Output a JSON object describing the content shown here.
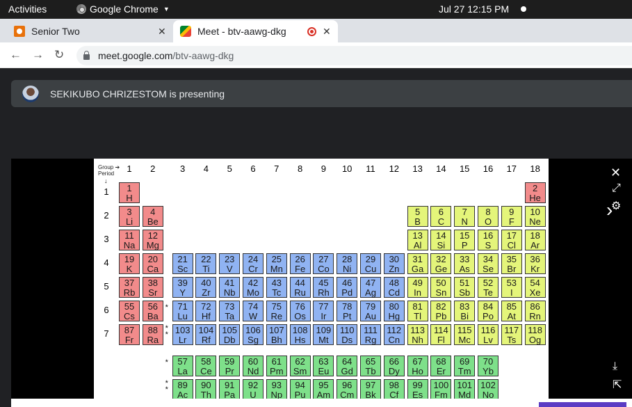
{
  "topbar": {
    "activities": "Activities",
    "app_name": "Google Chrome",
    "clock": "Jul 27  12:15 PM"
  },
  "tabs": [
    {
      "title": "Senior Two",
      "close": "✕"
    },
    {
      "title": "Meet - btv-aawg-dkg",
      "close": "✕"
    }
  ],
  "new_tab": "+",
  "nav": {
    "back": "←",
    "forward": "→",
    "reload": "↻"
  },
  "url": {
    "host": "meet.google.com",
    "path": "/btv-aawg-dkg"
  },
  "banner": {
    "text": "SEKIKUBO CHRIZESTOM is presenting"
  },
  "controls": {
    "close": "✕",
    "expand": "⤢",
    "settings": "⚙",
    "next": "›",
    "download": "⤓",
    "share": "⇱"
  },
  "periodic_table": {
    "header_group": "Group",
    "header_period": "Period",
    "groups": [
      "1",
      "2",
      "3",
      "4",
      "5",
      "6",
      "7",
      "8",
      "9",
      "10",
      "11",
      "12",
      "13",
      "14",
      "15",
      "16",
      "17",
      "18"
    ],
    "periods": [
      "1",
      "2",
      "3",
      "4",
      "5",
      "6",
      "7"
    ],
    "elements": [
      {
        "n": "1",
        "s": "H",
        "r": 1,
        "c": 1,
        "b": "s"
      },
      {
        "n": "2",
        "s": "He",
        "r": 1,
        "c": 18,
        "b": "s"
      },
      {
        "n": "3",
        "s": "Li",
        "r": 2,
        "c": 1,
        "b": "s"
      },
      {
        "n": "4",
        "s": "Be",
        "r": 2,
        "c": 2,
        "b": "s"
      },
      {
        "n": "5",
        "s": "B",
        "r": 2,
        "c": 13,
        "b": "p"
      },
      {
        "n": "6",
        "s": "C",
        "r": 2,
        "c": 14,
        "b": "p"
      },
      {
        "n": "7",
        "s": "N",
        "r": 2,
        "c": 15,
        "b": "p"
      },
      {
        "n": "8",
        "s": "O",
        "r": 2,
        "c": 16,
        "b": "p"
      },
      {
        "n": "9",
        "s": "F",
        "r": 2,
        "c": 17,
        "b": "p"
      },
      {
        "n": "10",
        "s": "Ne",
        "r": 2,
        "c": 18,
        "b": "p"
      },
      {
        "n": "11",
        "s": "Na",
        "r": 3,
        "c": 1,
        "b": "s"
      },
      {
        "n": "12",
        "s": "Mg",
        "r": 3,
        "c": 2,
        "b": "s"
      },
      {
        "n": "13",
        "s": "Al",
        "r": 3,
        "c": 13,
        "b": "p"
      },
      {
        "n": "14",
        "s": "Si",
        "r": 3,
        "c": 14,
        "b": "p"
      },
      {
        "n": "15",
        "s": "P",
        "r": 3,
        "c": 15,
        "b": "p"
      },
      {
        "n": "16",
        "s": "S",
        "r": 3,
        "c": 16,
        "b": "p"
      },
      {
        "n": "17",
        "s": "Cl",
        "r": 3,
        "c": 17,
        "b": "p"
      },
      {
        "n": "18",
        "s": "Ar",
        "r": 3,
        "c": 18,
        "b": "p"
      },
      {
        "n": "19",
        "s": "K",
        "r": 4,
        "c": 1,
        "b": "s"
      },
      {
        "n": "20",
        "s": "Ca",
        "r": 4,
        "c": 2,
        "b": "s"
      },
      {
        "n": "21",
        "s": "Sc",
        "r": 4,
        "c": 3,
        "b": "d"
      },
      {
        "n": "22",
        "s": "Ti",
        "r": 4,
        "c": 4,
        "b": "d"
      },
      {
        "n": "23",
        "s": "V",
        "r": 4,
        "c": 5,
        "b": "d"
      },
      {
        "n": "24",
        "s": "Cr",
        "r": 4,
        "c": 6,
        "b": "d"
      },
      {
        "n": "25",
        "s": "Mn",
        "r": 4,
        "c": 7,
        "b": "d"
      },
      {
        "n": "26",
        "s": "Fe",
        "r": 4,
        "c": 8,
        "b": "d"
      },
      {
        "n": "27",
        "s": "Co",
        "r": 4,
        "c": 9,
        "b": "d"
      },
      {
        "n": "28",
        "s": "Ni",
        "r": 4,
        "c": 10,
        "b": "d"
      },
      {
        "n": "29",
        "s": "Cu",
        "r": 4,
        "c": 11,
        "b": "d"
      },
      {
        "n": "30",
        "s": "Zn",
        "r": 4,
        "c": 12,
        "b": "d"
      },
      {
        "n": "31",
        "s": "Ga",
        "r": 4,
        "c": 13,
        "b": "p"
      },
      {
        "n": "32",
        "s": "Ge",
        "r": 4,
        "c": 14,
        "b": "p"
      },
      {
        "n": "33",
        "s": "As",
        "r": 4,
        "c": 15,
        "b": "p"
      },
      {
        "n": "34",
        "s": "Se",
        "r": 4,
        "c": 16,
        "b": "p"
      },
      {
        "n": "35",
        "s": "Br",
        "r": 4,
        "c": 17,
        "b": "p"
      },
      {
        "n": "36",
        "s": "Kr",
        "r": 4,
        "c": 18,
        "b": "p"
      },
      {
        "n": "37",
        "s": "Rb",
        "r": 5,
        "c": 1,
        "b": "s"
      },
      {
        "n": "38",
        "s": "Sr",
        "r": 5,
        "c": 2,
        "b": "s"
      },
      {
        "n": "39",
        "s": "Y",
        "r": 5,
        "c": 3,
        "b": "d"
      },
      {
        "n": "40",
        "s": "Zr",
        "r": 5,
        "c": 4,
        "b": "d"
      },
      {
        "n": "41",
        "s": "Nb",
        "r": 5,
        "c": 5,
        "b": "d"
      },
      {
        "n": "42",
        "s": "Mo",
        "r": 5,
        "c": 6,
        "b": "d"
      },
      {
        "n": "43",
        "s": "Tc",
        "r": 5,
        "c": 7,
        "b": "d"
      },
      {
        "n": "44",
        "s": "Ru",
        "r": 5,
        "c": 8,
        "b": "d"
      },
      {
        "n": "45",
        "s": "Rh",
        "r": 5,
        "c": 9,
        "b": "d"
      },
      {
        "n": "46",
        "s": "Pd",
        "r": 5,
        "c": 10,
        "b": "d"
      },
      {
        "n": "47",
        "s": "Ag",
        "r": 5,
        "c": 11,
        "b": "d"
      },
      {
        "n": "48",
        "s": "Cd",
        "r": 5,
        "c": 12,
        "b": "d"
      },
      {
        "n": "49",
        "s": "In",
        "r": 5,
        "c": 13,
        "b": "p"
      },
      {
        "n": "50",
        "s": "Sn",
        "r": 5,
        "c": 14,
        "b": "p"
      },
      {
        "n": "51",
        "s": "Sb",
        "r": 5,
        "c": 15,
        "b": "p"
      },
      {
        "n": "52",
        "s": "Te",
        "r": 5,
        "c": 16,
        "b": "p"
      },
      {
        "n": "53",
        "s": "I",
        "r": 5,
        "c": 17,
        "b": "p"
      },
      {
        "n": "54",
        "s": "Xe",
        "r": 5,
        "c": 18,
        "b": "p"
      },
      {
        "n": "55",
        "s": "Cs",
        "r": 6,
        "c": 1,
        "b": "s"
      },
      {
        "n": "56",
        "s": "Ba",
        "r": 6,
        "c": 2,
        "b": "s"
      },
      {
        "n": "71",
        "s": "Lu",
        "r": 6,
        "c": 3,
        "b": "d"
      },
      {
        "n": "72",
        "s": "Hf",
        "r": 6,
        "c": 4,
        "b": "d"
      },
      {
        "n": "73",
        "s": "Ta",
        "r": 6,
        "c": 5,
        "b": "d"
      },
      {
        "n": "74",
        "s": "W",
        "r": 6,
        "c": 6,
        "b": "d"
      },
      {
        "n": "75",
        "s": "Re",
        "r": 6,
        "c": 7,
        "b": "d"
      },
      {
        "n": "76",
        "s": "Os",
        "r": 6,
        "c": 8,
        "b": "d"
      },
      {
        "n": "77",
        "s": "Ir",
        "r": 6,
        "c": 9,
        "b": "d"
      },
      {
        "n": "78",
        "s": "Pt",
        "r": 6,
        "c": 10,
        "b": "d"
      },
      {
        "n": "79",
        "s": "Au",
        "r": 6,
        "c": 11,
        "b": "d"
      },
      {
        "n": "80",
        "s": "Hg",
        "r": 6,
        "c": 12,
        "b": "d"
      },
      {
        "n": "81",
        "s": "Tl",
        "r": 6,
        "c": 13,
        "b": "p"
      },
      {
        "n": "82",
        "s": "Pb",
        "r": 6,
        "c": 14,
        "b": "p"
      },
      {
        "n": "83",
        "s": "Bi",
        "r": 6,
        "c": 15,
        "b": "p"
      },
      {
        "n": "84",
        "s": "Po",
        "r": 6,
        "c": 16,
        "b": "p"
      },
      {
        "n": "85",
        "s": "At",
        "r": 6,
        "c": 17,
        "b": "p"
      },
      {
        "n": "86",
        "s": "Rn",
        "r": 6,
        "c": 18,
        "b": "p"
      },
      {
        "n": "87",
        "s": "Fr",
        "r": 7,
        "c": 1,
        "b": "s"
      },
      {
        "n": "88",
        "s": "Ra",
        "r": 7,
        "c": 2,
        "b": "s"
      },
      {
        "n": "103",
        "s": "Lr",
        "r": 7,
        "c": 3,
        "b": "d"
      },
      {
        "n": "104",
        "s": "Rf",
        "r": 7,
        "c": 4,
        "b": "d"
      },
      {
        "n": "105",
        "s": "Db",
        "r": 7,
        "c": 5,
        "b": "d"
      },
      {
        "n": "106",
        "s": "Sg",
        "r": 7,
        "c": 6,
        "b": "d"
      },
      {
        "n": "107",
        "s": "Bh",
        "r": 7,
        "c": 7,
        "b": "d"
      },
      {
        "n": "108",
        "s": "Hs",
        "r": 7,
        "c": 8,
        "b": "d"
      },
      {
        "n": "109",
        "s": "Mt",
        "r": 7,
        "c": 9,
        "b": "d"
      },
      {
        "n": "110",
        "s": "Ds",
        "r": 7,
        "c": 10,
        "b": "d"
      },
      {
        "n": "111",
        "s": "Rg",
        "r": 7,
        "c": 11,
        "b": "d"
      },
      {
        "n": "112",
        "s": "Cn",
        "r": 7,
        "c": 12,
        "b": "d"
      },
      {
        "n": "113",
        "s": "Nh",
        "r": 7,
        "c": 13,
        "b": "p"
      },
      {
        "n": "114",
        "s": "Fl",
        "r": 7,
        "c": 14,
        "b": "p"
      },
      {
        "n": "115",
        "s": "Mc",
        "r": 7,
        "c": 15,
        "b": "p"
      },
      {
        "n": "116",
        "s": "Lv",
        "r": 7,
        "c": 16,
        "b": "p"
      },
      {
        "n": "117",
        "s": "Ts",
        "r": 7,
        "c": 17,
        "b": "p"
      },
      {
        "n": "118",
        "s": "Og",
        "r": 7,
        "c": 18,
        "b": "p"
      },
      {
        "n": "57",
        "s": "La",
        "r": 8,
        "c": 3,
        "b": "f"
      },
      {
        "n": "58",
        "s": "Ce",
        "r": 8,
        "c": 4,
        "b": "f"
      },
      {
        "n": "59",
        "s": "Pr",
        "r": 8,
        "c": 5,
        "b": "f"
      },
      {
        "n": "60",
        "s": "Nd",
        "r": 8,
        "c": 6,
        "b": "f"
      },
      {
        "n": "61",
        "s": "Pm",
        "r": 8,
        "c": 7,
        "b": "f"
      },
      {
        "n": "62",
        "s": "Sm",
        "r": 8,
        "c": 8,
        "b": "f"
      },
      {
        "n": "63",
        "s": "Eu",
        "r": 8,
        "c": 9,
        "b": "f"
      },
      {
        "n": "64",
        "s": "Gd",
        "r": 8,
        "c": 10,
        "b": "f"
      },
      {
        "n": "65",
        "s": "Tb",
        "r": 8,
        "c": 11,
        "b": "f"
      },
      {
        "n": "66",
        "s": "Dy",
        "r": 8,
        "c": 12,
        "b": "f"
      },
      {
        "n": "67",
        "s": "Ho",
        "r": 8,
        "c": 13,
        "b": "f"
      },
      {
        "n": "68",
        "s": "Er",
        "r": 8,
        "c": 14,
        "b": "f"
      },
      {
        "n": "69",
        "s": "Tm",
        "r": 8,
        "c": 15,
        "b": "f"
      },
      {
        "n": "70",
        "s": "Yb",
        "r": 8,
        "c": 16,
        "b": "f"
      },
      {
        "n": "89",
        "s": "Ac",
        "r": 9,
        "c": 3,
        "b": "f"
      },
      {
        "n": "90",
        "s": "Th",
        "r": 9,
        "c": 4,
        "b": "f"
      },
      {
        "n": "91",
        "s": "Pa",
        "r": 9,
        "c": 5,
        "b": "f"
      },
      {
        "n": "92",
        "s": "U",
        "r": 9,
        "c": 6,
        "b": "f"
      },
      {
        "n": "93",
        "s": "Np",
        "r": 9,
        "c": 7,
        "b": "f"
      },
      {
        "n": "94",
        "s": "Pu",
        "r": 9,
        "c": 8,
        "b": "f"
      },
      {
        "n": "95",
        "s": "Am",
        "r": 9,
        "c": 9,
        "b": "f"
      },
      {
        "n": "96",
        "s": "Cm",
        "r": 9,
        "c": 10,
        "b": "f"
      },
      {
        "n": "97",
        "s": "Bk",
        "r": 9,
        "c": 11,
        "b": "f"
      },
      {
        "n": "98",
        "s": "Cf",
        "r": 9,
        "c": 12,
        "b": "f"
      },
      {
        "n": "99",
        "s": "Es",
        "r": 9,
        "c": 13,
        "b": "f"
      },
      {
        "n": "100",
        "s": "Fm",
        "r": 9,
        "c": 14,
        "b": "f"
      },
      {
        "n": "101",
        "s": "Md",
        "r": 9,
        "c": 15,
        "b": "f"
      },
      {
        "n": "102",
        "s": "No",
        "r": 9,
        "c": 16,
        "b": "f"
      }
    ],
    "colors": {
      "s": "#f28b8b",
      "d": "#90b3f2",
      "p": "#e4f57a",
      "f": "#7ee08a"
    }
  }
}
